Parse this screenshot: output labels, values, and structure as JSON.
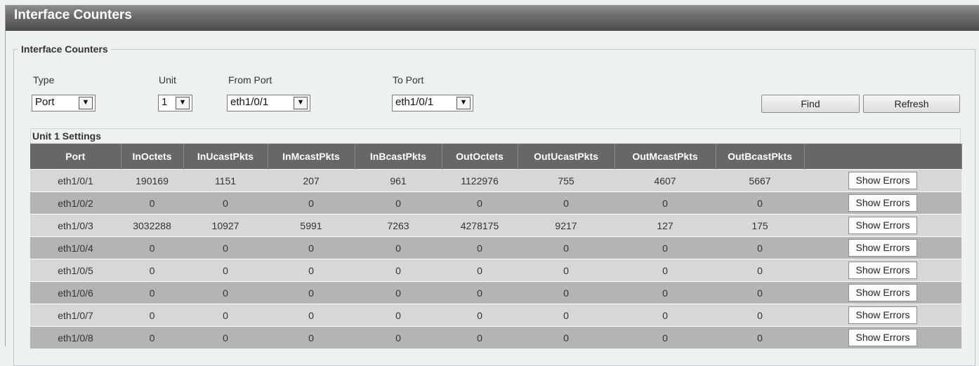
{
  "page": {
    "title": "Interface Counters"
  },
  "group": {
    "legend": "Interface Counters"
  },
  "filters": {
    "type_label": "Type",
    "type_value": "Port",
    "unit_label": "Unit",
    "unit_value": "1",
    "from_port_label": "From Port",
    "from_port_value": "eth1/0/1",
    "to_port_label": "To Port",
    "to_port_value": "eth1/0/1",
    "find_label": "Find",
    "refresh_label": "Refresh"
  },
  "section": {
    "title": "Unit 1 Settings"
  },
  "table": {
    "columns": [
      "Port",
      "InOctets",
      "InUcastPkts",
      "InMcastPkts",
      "InBcastPkts",
      "OutOctets",
      "OutUcastPkts",
      "OutMcastPkts",
      "OutBcastPkts",
      ""
    ],
    "action_label": "Show Errors",
    "rows": [
      [
        "eth1/0/1",
        "190169",
        "1151",
        "207",
        "961",
        "1122976",
        "755",
        "4607",
        "5667"
      ],
      [
        "eth1/0/2",
        "0",
        "0",
        "0",
        "0",
        "0",
        "0",
        "0",
        "0"
      ],
      [
        "eth1/0/3",
        "3032288",
        "10927",
        "5991",
        "7263",
        "4278175",
        "9217",
        "127",
        "175"
      ],
      [
        "eth1/0/4",
        "0",
        "0",
        "0",
        "0",
        "0",
        "0",
        "0",
        "0"
      ],
      [
        "eth1/0/5",
        "0",
        "0",
        "0",
        "0",
        "0",
        "0",
        "0",
        "0"
      ],
      [
        "eth1/0/6",
        "0",
        "0",
        "0",
        "0",
        "0",
        "0",
        "0",
        "0"
      ],
      [
        "eth1/0/7",
        "0",
        "0",
        "0",
        "0",
        "0",
        "0",
        "0",
        "0"
      ],
      [
        "eth1/0/8",
        "0",
        "0",
        "0",
        "0",
        "0",
        "0",
        "0",
        "0"
      ]
    ]
  },
  "icons": {
    "dropdown": "chevron-down-icon"
  }
}
